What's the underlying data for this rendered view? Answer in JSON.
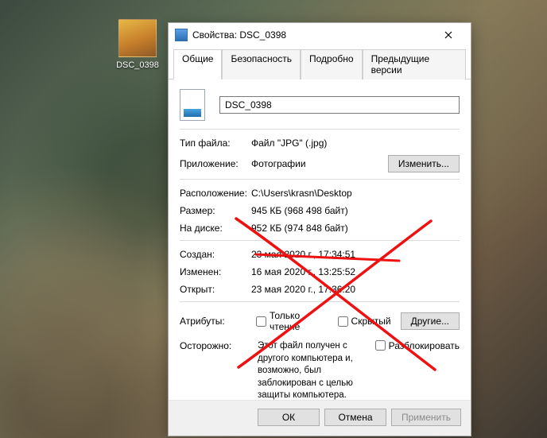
{
  "desktop": {
    "file_label": "DSC_0398"
  },
  "dialog": {
    "title": "Свойства: DSC_0398",
    "tabs": {
      "general": "Общие",
      "security": "Безопасность",
      "details": "Подробно",
      "previous": "Предыдущие версии"
    },
    "filename": "DSC_0398",
    "labels": {
      "filetype": "Тип файла:",
      "app": "Приложение:",
      "change": "Изменить...",
      "location": "Расположение:",
      "size": "Размер:",
      "ondisk": "На диске:",
      "created": "Создан:",
      "modified": "Изменен:",
      "accessed": "Открыт:",
      "attributes": "Атрибуты:",
      "readonly": "Только чтение",
      "hidden": "Скрытый",
      "other": "Другие...",
      "cautious": "Осторожно:",
      "unblock": "Разблокировать"
    },
    "values": {
      "filetype": "Файл \"JPG\" (.jpg)",
      "app": "Фотографии",
      "location": "C:\\Users\\krasn\\Desktop",
      "size": "945 КБ (968 498 байт)",
      "ondisk": "952 КБ (974 848 байт)",
      "created": "23 мая 2020 г., 17:34:51",
      "modified": "16 мая 2020 г., 13:25:52",
      "accessed": "23 мая 2020 г., 17:36:20",
      "security_text": "Этот файл получен с другого компьютера и, возможно, был заблокирован с целью защиты компьютера."
    },
    "footer": {
      "ok": "ОК",
      "cancel": "Отмена",
      "apply": "Применить"
    }
  }
}
